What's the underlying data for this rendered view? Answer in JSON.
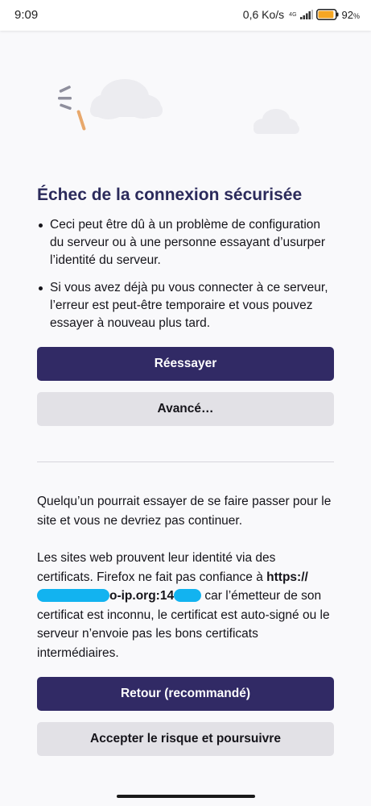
{
  "status_bar": {
    "time": "9:09",
    "net_speed": "0,6 Ko/s",
    "network_type": "4G",
    "battery_percent": "92",
    "battery_unit": "%",
    "battery_level": 0.92,
    "battery_color": "#f5a623"
  },
  "error": {
    "title": "Échec de la connexion sécurisée",
    "bullets": [
      "Ceci peut être dû à un problème de configuration du serveur ou à une personne essayant d’usurper l’identité du serveur.",
      "Si vous avez déjà pu vous connecter à ce serveur, l’erreur est peut-être temporaire et vous pouvez essayer à nouveau plus tard."
    ],
    "retry_label": "Réessayer",
    "advanced_label": "Avancé…"
  },
  "advanced": {
    "warning_text": "Quelqu’un pourrait essayer de se faire passer pour le site et vous ne devriez pas continuer.",
    "cert_text_before": "Les sites web prouvent leur identité via des certificats. Firefox ne fait pas confiance à ",
    "cert_url_prefix": "https://",
    "cert_url_visible_mid": "o-ip.org:14",
    "cert_text_after": "car l’émetteur de son certificat est inconnu, le certificat est auto-signé ou le serveur n’envoie pas les bons certificats intermédiaires.",
    "back_label": "Retour (recommandé)",
    "accept_label": "Accepter le risque et poursuivre"
  },
  "colors": {
    "primary": "#312a65",
    "title": "#2b2a5b",
    "secondary": "#e2e1e6",
    "redaction": "#12b3f0",
    "background": "#f9f9fb"
  }
}
